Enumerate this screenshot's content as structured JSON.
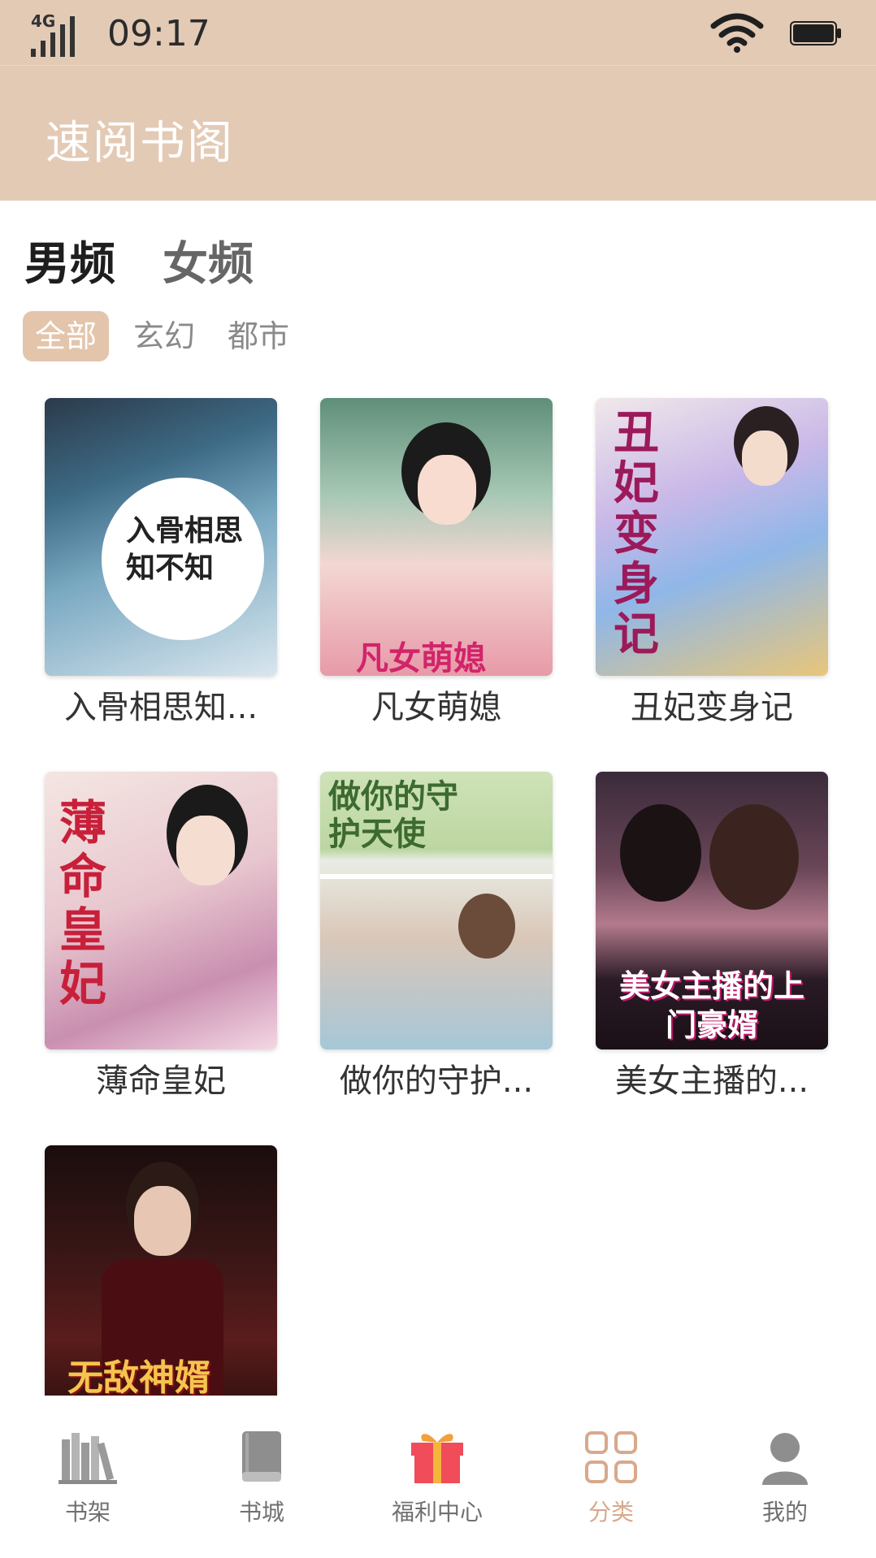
{
  "status_bar": {
    "network": "4G",
    "time": "09:17"
  },
  "app_title": "速阅书阁",
  "gender_tabs": [
    {
      "label": "男频",
      "active": true
    },
    {
      "label": "女频",
      "active": false
    }
  ],
  "categories": [
    {
      "label": "全部",
      "active": true
    },
    {
      "label": "玄幻",
      "active": false
    },
    {
      "label": "都市",
      "active": false
    }
  ],
  "books": [
    {
      "title": "入骨相思知...",
      "cover_text": "入骨相思知不知"
    },
    {
      "title": "凡女萌媳",
      "cover_text": "凡女萌媳"
    },
    {
      "title": "丑妃变身记",
      "cover_text": "丑妃变身记"
    },
    {
      "title": "薄命皇妃",
      "cover_text": "薄命皇妃"
    },
    {
      "title": "做你的守护...",
      "cover_text": "做你的守护天使"
    },
    {
      "title": "美女主播的...",
      "cover_text": "美女主播的上门豪婿"
    },
    {
      "title": "",
      "cover_text": "无敌神婿"
    }
  ],
  "bottom_nav": [
    {
      "label": "书架",
      "icon": "bookshelf-icon",
      "active": false
    },
    {
      "label": "书城",
      "icon": "book-icon",
      "active": false
    },
    {
      "label": "福利中心",
      "icon": "gift-icon",
      "active": false
    },
    {
      "label": "分类",
      "icon": "grid-icon",
      "active": true
    },
    {
      "label": "我的",
      "icon": "user-icon",
      "active": false
    }
  ],
  "colors": {
    "accent": "#e3cab5",
    "chip_active": "#e3c5ab",
    "nav_active": "#d8a98c",
    "gift": "#f04c5a"
  }
}
